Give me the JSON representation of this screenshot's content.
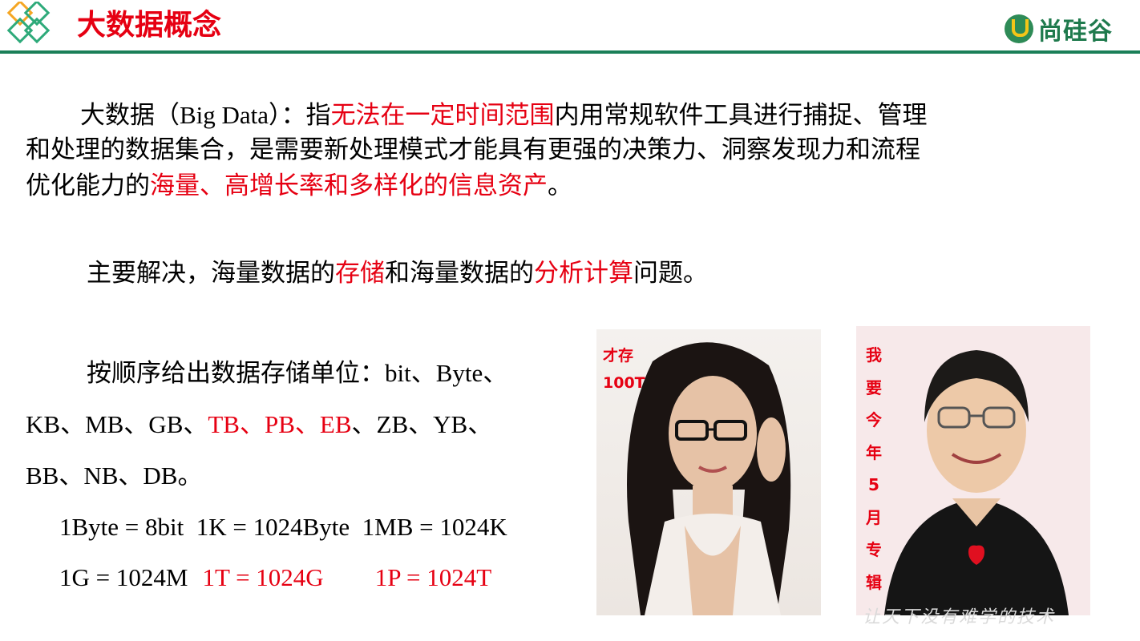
{
  "header": {
    "title": "大数据概念",
    "brand": "尚硅谷",
    "accent_color": "#e60012",
    "brand_color": "#1a7f58"
  },
  "definition": {
    "line1": [
      "大数据",
      "（Big Data）",
      "：指",
      "无法在一定时间范围",
      "内用常规软件工具进行捕捉、管理"
    ],
    "line2": "和处理的数据集合，是需要新处理模式才能具有更强的决策力、洞察发现力和流程",
    "line3": [
      "优化能力的",
      "海量、高增长率和多样化的信息资产",
      "。"
    ]
  },
  "problem": {
    "parts": [
      "主要解决，海量数据的",
      "存储",
      "和海量数据的",
      "分析计算",
      "问题。"
    ]
  },
  "units": {
    "intro": "按顺序给出数据存储单位：",
    "line1_units": "bit、Byte、",
    "line2": [
      "KB、MB、GB、",
      "TB、PB、EB",
      "、ZB、YB、"
    ],
    "line3": "BB、NB、DB。",
    "conv1": "1Byte = 8bit  1K = 1024Byte  1MB = 1024K",
    "conv2_black": "1G = 1024M",
    "conv2_red1": "1T = 1024G",
    "conv2_red2": "1P = 1024T"
  },
  "photos": {
    "left_caption_line1": "才存",
    "left_caption_line2": "100T",
    "right_caption": [
      "我",
      "要",
      "今",
      "年",
      "5",
      "月",
      "专",
      "辑"
    ]
  },
  "watermark": "让天下没有难学的技术"
}
